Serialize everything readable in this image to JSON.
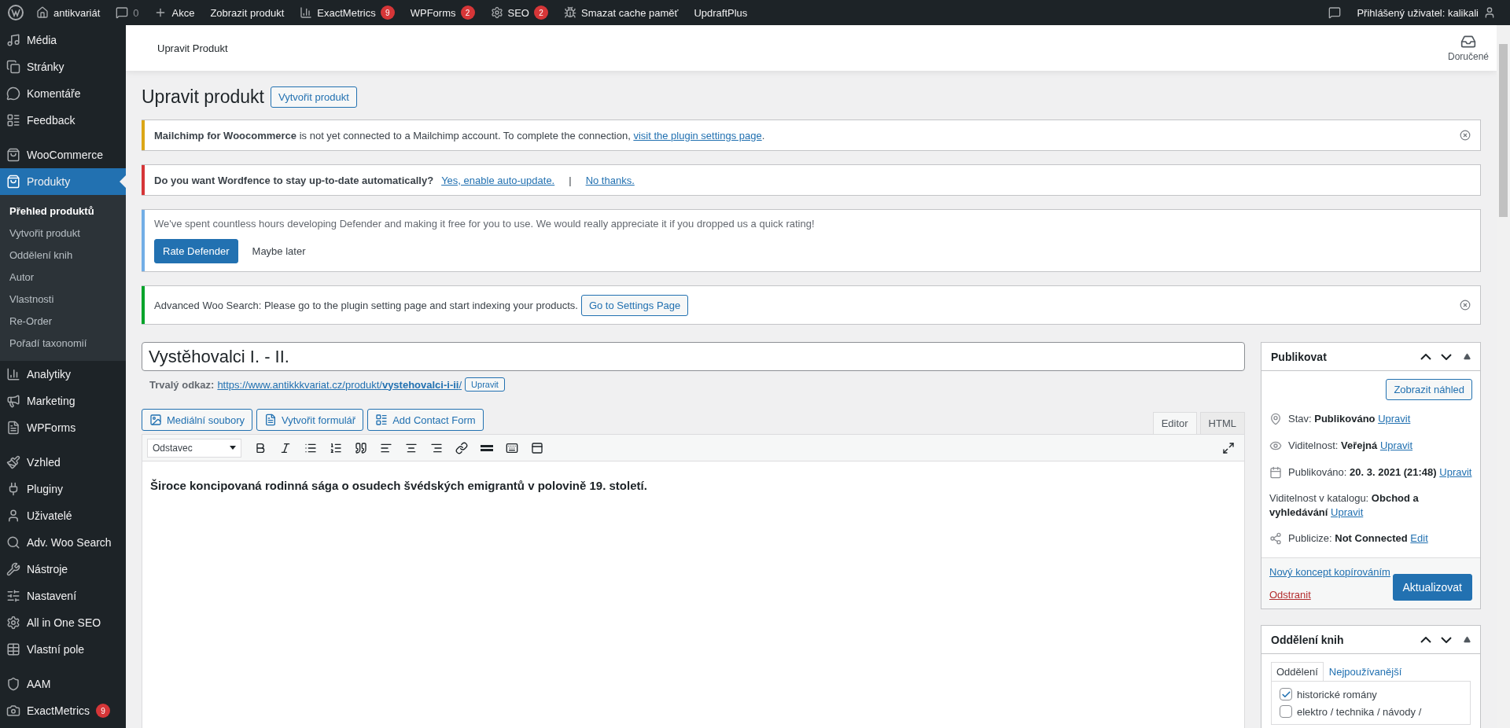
{
  "admin_bar": {
    "items": [
      {
        "kind": "link",
        "label": "antikvariát"
      },
      {
        "kind": "count",
        "label": "0"
      },
      {
        "kind": "link",
        "label": "Akce"
      },
      {
        "kind": "link",
        "label": "Zobrazit produkt"
      },
      {
        "kind": "link",
        "label": "ExactMetrics",
        "badge": "9"
      },
      {
        "kind": "link",
        "label": "WPForms",
        "badge": "2"
      },
      {
        "kind": "link",
        "label": "SEO",
        "badge": "2"
      },
      {
        "kind": "link",
        "label": "Smazat cache paměť"
      },
      {
        "kind": "link",
        "label": "UpdraftPlus"
      }
    ],
    "user": "Přihlášený uživatel: kalikali"
  },
  "sidebar": {
    "groups": [
      [
        {
          "label": "Média",
          "selected": false
        },
        {
          "label": "Stránky",
          "selected": false
        },
        {
          "label": "Komentáře",
          "selected": false
        },
        {
          "label": "Feedback",
          "selected": false
        }
      ],
      [
        {
          "label": "WooCommerce",
          "selected": false
        },
        {
          "label": "Produkty",
          "selected": true,
          "children": [
            {
              "label": "Přehled produktů",
              "selected": true
            },
            {
              "label": "Vytvořit produkt",
              "selected": false
            },
            {
              "label": "Oddělení knih",
              "selected": false
            },
            {
              "label": "Autor",
              "selected": false
            },
            {
              "label": "Vlastnosti",
              "selected": false
            },
            {
              "label": "Re-Order",
              "selected": false
            },
            {
              "label": "Pořadí taxonomií",
              "selected": false
            }
          ]
        },
        {
          "label": "Analytiky",
          "selected": false
        },
        {
          "label": "Marketing",
          "selected": false
        },
        {
          "label": "WPForms",
          "selected": false
        }
      ],
      [
        {
          "label": "Vzhled",
          "selected": false
        },
        {
          "label": "Pluginy",
          "selected": false
        },
        {
          "label": "Uživatelé",
          "selected": false
        },
        {
          "label": "Adv. Woo Search",
          "selected": false
        },
        {
          "label": "Nástroje",
          "selected": false
        },
        {
          "label": "Nastavení",
          "selected": false
        },
        {
          "label": "All in One SEO",
          "selected": false
        },
        {
          "label": "Vlastní pole",
          "selected": false
        }
      ],
      [
        {
          "label": "AAM",
          "selected": false
        },
        {
          "label": "ExactMetrics",
          "selected": false,
          "badge": "9"
        }
      ]
    ]
  },
  "header": {
    "title": "Upravit Produkt",
    "inbox": "Doručené"
  },
  "page": {
    "heading": "Upravit produkt",
    "add_new": "Vytvořit produkt"
  },
  "notices": [
    {
      "kind": "message",
      "color": "#dba617",
      "dismissible": true,
      "text": "**Mailchimp for Woocommerce** is not yet connected to a Mailchimp account. To complete the connection, ",
      "links": [
        "visit the plugin settings page"
      ],
      "after": "."
    },
    {
      "kind": "question",
      "color": "#d63638",
      "dismissible": false,
      "text": "Do you want Wordfence to stay up-to-date automatically?",
      "links": [
        "Yes, enable auto-update.",
        "No thanks."
      ],
      "separator": "|"
    },
    {
      "kind": "rating",
      "color": "#72aee6",
      "dismissible": false,
      "text": "We've spent countless hours developing Defender and making it free for you to use. We would really appreciate it if you dropped us a quick rating!",
      "buttons": [
        {
          "label": "Rate Defender",
          "primary": true
        },
        {
          "label": "Maybe later",
          "primary": false
        }
      ]
    },
    {
      "kind": "action",
      "color": "#00a32a",
      "dismissible": true,
      "text": "Advanced Woo Search: Please go to the plugin setting page and start indexing your products.",
      "buttons": [
        {
          "label": "Go to Settings Page",
          "primary": false
        }
      ]
    }
  ],
  "post": {
    "title": "Vystěhovalci I. - II.",
    "permalink_label": "Trvalý odkaz:",
    "permalink": "https://www.antikkkvariat.cz/produkt/**vystehovalci-i-ii**/",
    "permalink_edit": "Upravit",
    "media_buttons": [
      "Mediální soubory",
      "Vytvořit formulář",
      "Add Contact Form"
    ],
    "editor_tabs": [
      {
        "label": "Editor",
        "selected": true
      },
      {
        "label": "HTML",
        "selected": false
      }
    ],
    "format": "Odstavec",
    "content": "Široce koncipovaná rodinná sága o osudech švédských emigrantů v polovině 19. století."
  },
  "publish": {
    "title": "Publikovat",
    "preview": "Zobrazit náhled",
    "rows": [
      {
        "label": "Stav:",
        "value": "Publikováno",
        "link": "Upravit"
      },
      {
        "label": "Viditelnost:",
        "value": "Veřejná",
        "link": "Upravit"
      },
      {
        "label": "Publikováno:",
        "value": "20. 3. 2021 (21:48)",
        "link": "Upravit"
      },
      {
        "label": "Viditelnost v katalogu:",
        "value": "Obchod a vyhledávání",
        "link": "Upravit"
      },
      {
        "label": "Publicize:",
        "value": "Not Connected",
        "link": "Edit"
      }
    ],
    "copy_link": "Nový koncept kopírováním",
    "delete_link": "Odstranit",
    "update": "Aktualizovat"
  },
  "categories": {
    "title": "Oddělení knih",
    "tabs": [
      {
        "label": "Oddělení",
        "selected": true
      },
      {
        "label": "Nejpoužívanější",
        "selected": false
      }
    ],
    "items": [
      {
        "label": "historické romány",
        "checked": true
      },
      {
        "label": "elektro / technika / návody /",
        "checked": false
      }
    ]
  }
}
